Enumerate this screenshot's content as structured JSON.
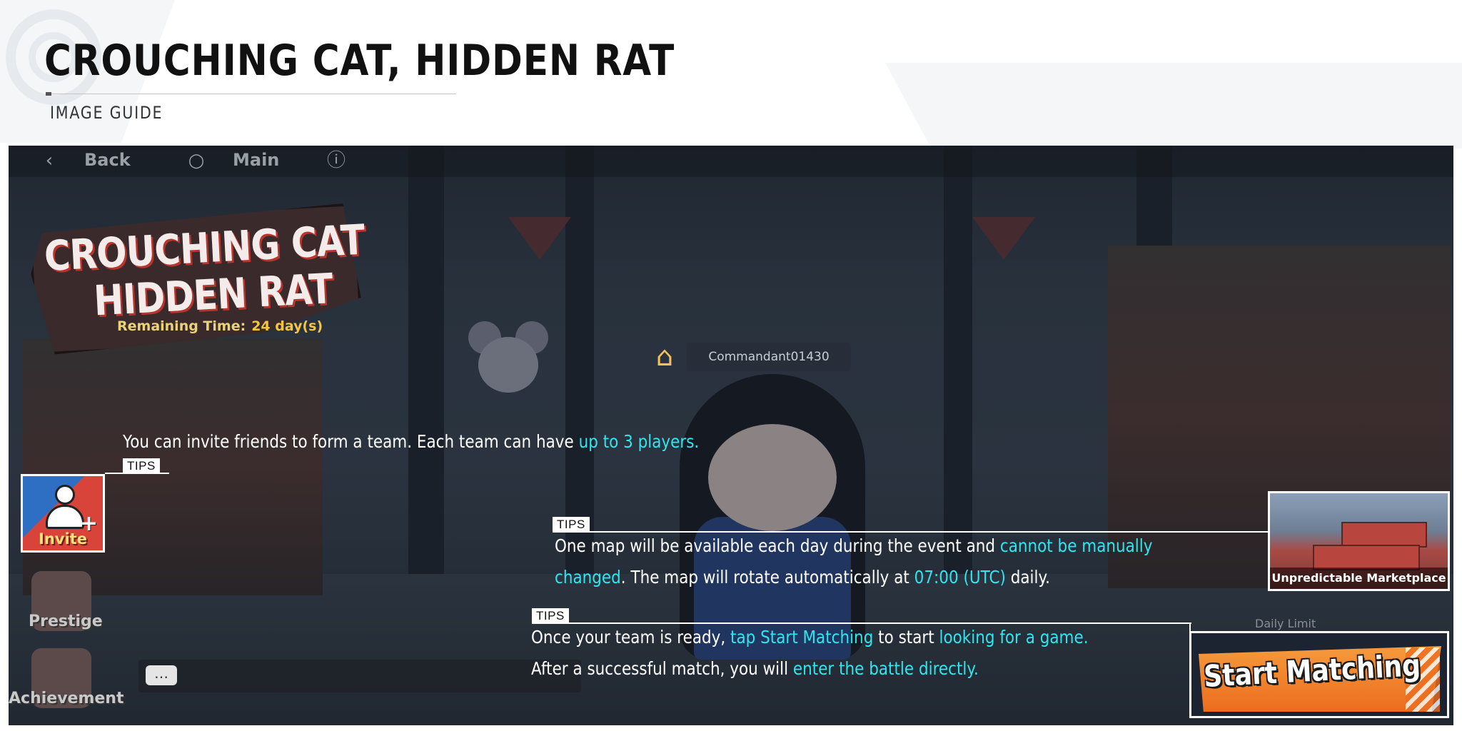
{
  "header": {
    "title": "CROUCHING CAT, HIDDEN RAT",
    "subtitle": "IMAGE GUIDE"
  },
  "game": {
    "topbar": {
      "back_label": "Back",
      "main_label": "Main"
    },
    "logo": {
      "line1": "CROUCHING CAT",
      "line2": "HIDDEN RAT",
      "remaining_label": "Remaining Time:",
      "remaining_value": "24 day(s)"
    },
    "player_name": "Commandant01430",
    "side_buttons": {
      "invite": "Invite",
      "prestige": "Prestige",
      "achievement": "Achievement"
    },
    "map_name": "Unpredictable Marketplace",
    "daily_limit": "Daily Limit",
    "start_button": "Start Matching"
  },
  "tips": {
    "tag_label": "TIPS",
    "invite": {
      "t1": "You can invite friends to form a team. Each team can have ",
      "h1": "up to 3 players."
    },
    "map": {
      "t1": "One map will be available each day during the event and ",
      "h1": "cannot be manually",
      "h2": "changed",
      "t2": ". The map will rotate automatically at ",
      "h3": "07:00 (UTC)",
      "t3": " daily."
    },
    "match": {
      "t1": "Once your team is ready, ",
      "h1": "tap Start Matching",
      "t2": " to start ",
      "h2": "looking for a game.",
      "t3": "After a successful match, you will ",
      "h3": "enter the battle directly."
    }
  },
  "colors": {
    "highlight": "#2ee6f0",
    "start_button": "#ec6d1f"
  }
}
